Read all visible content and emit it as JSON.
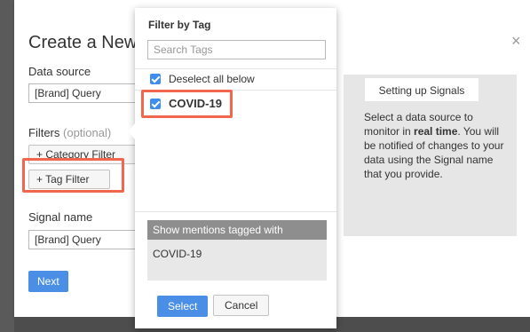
{
  "modal": {
    "title": "Create a New Signal",
    "close": "×",
    "data_source_label": "Data source",
    "data_source_value": "[Brand] Query",
    "filters_label": "Filters",
    "filters_optional": "(optional)",
    "category_filter_button": "+ Category Filter",
    "tag_filter_button": "+ Tag Filter",
    "signal_name_label": "Signal name",
    "signal_name_value": "[Brand] Query",
    "next_button": "Next"
  },
  "info": {
    "title": "Setting up Signals",
    "text_before": "Select a data source to monitor in ",
    "text_bold": "real time",
    "text_after": ". You will be notified of changes to your data using the Signal name that you provide."
  },
  "popover": {
    "title": "Filter by Tag",
    "search_placeholder": "Search Tags",
    "deselect_all": "Deselect all below",
    "tags": [
      {
        "label": "COVID-19",
        "checked": true
      }
    ],
    "mentions_header": "Show mentions tagged with",
    "mentions_value": "COVID-19",
    "select_button": "Select",
    "cancel_button": "Cancel"
  },
  "colors": {
    "primary": "#4a8ee6",
    "highlight": "#f0674e",
    "checkbox": "#3d8ef0"
  }
}
